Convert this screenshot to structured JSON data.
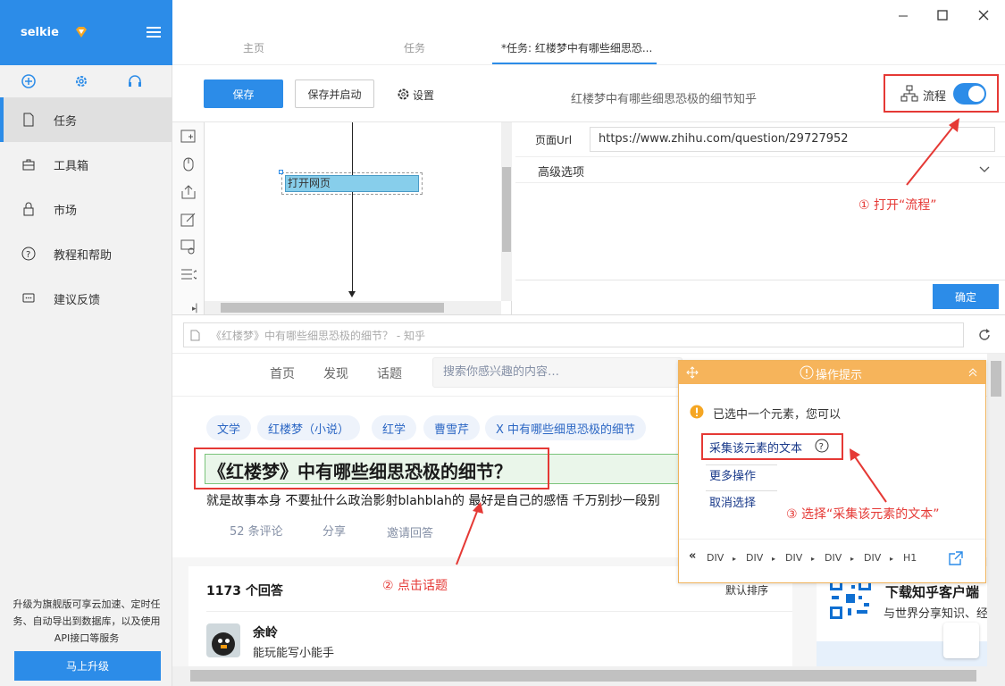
{
  "app": {
    "name": "selkie",
    "upgrade_text": "升级为旗舰版可享云加速、定时任务、自动导出到数据库，以及使用API接口等服务",
    "upgrade_button": "马上升级"
  },
  "sidebar": {
    "items": [
      {
        "label": "任务"
      },
      {
        "label": "工具箱"
      },
      {
        "label": "市场"
      },
      {
        "label": "教程和帮助"
      },
      {
        "label": "建议反馈"
      }
    ]
  },
  "tabs": [
    {
      "label": "主页"
    },
    {
      "label": "任务"
    },
    {
      "label": "*任务: 红楼梦中有哪些细思恐..."
    }
  ],
  "toolbar": {
    "save": "保存",
    "save_start": "保存并启动",
    "settings": "设置",
    "task_title": "红楼梦中有哪些细思恐极的细节知乎",
    "flow_label": "流程"
  },
  "flow": {
    "node_label": "打开网页"
  },
  "props": {
    "url_label": "页面Url",
    "url_value": "https://www.zhihu.com/question/29727952",
    "advanced": "高级选项",
    "confirm": "确定"
  },
  "browser": {
    "address": "《红楼梦》中有哪些细思恐极的细节？ - 知乎"
  },
  "zhihu": {
    "nav": [
      "首页",
      "发现",
      "话题"
    ],
    "search_placeholder": "搜索你感兴趣的内容…",
    "topics": [
      "文学",
      "红楼梦（小说）",
      "红学",
      "曹雪芹",
      "X 中有哪些细思恐极的细节"
    ],
    "question_title": "《红楼梦》中有哪些细思恐极的细节？",
    "question_desc": "就是故事本身 不要扯什么政治影射blahblah的 最好是自己的感悟 千万别抄一段别",
    "actions": [
      "52 条评论",
      "分享",
      "邀请回答"
    ],
    "answers_count": "1173 个回答",
    "sort": "默认排序",
    "author_name": "余岭",
    "author_bio": "能玩能写小能手",
    "download_title": "下载知乎客户端",
    "download_sub": "与世界分享知识、经"
  },
  "tip": {
    "title": "操作提示",
    "selected": "已选中一个元素，您可以",
    "collect": "采集该元素的文本",
    "more": "更多操作",
    "cancel": "取消选择",
    "breadcrumb": [
      "DIV",
      "DIV",
      "DIV",
      "DIV",
      "DIV",
      "H1"
    ]
  },
  "annotations": {
    "a1": "① 打开“流程”",
    "a2": "② 点击话题",
    "a3": "③ 选择“采集该元素的文本”"
  },
  "colors": {
    "primary": "#2c8ce8",
    "annotation": "#e53935",
    "tip_header": "#f6b45b"
  }
}
